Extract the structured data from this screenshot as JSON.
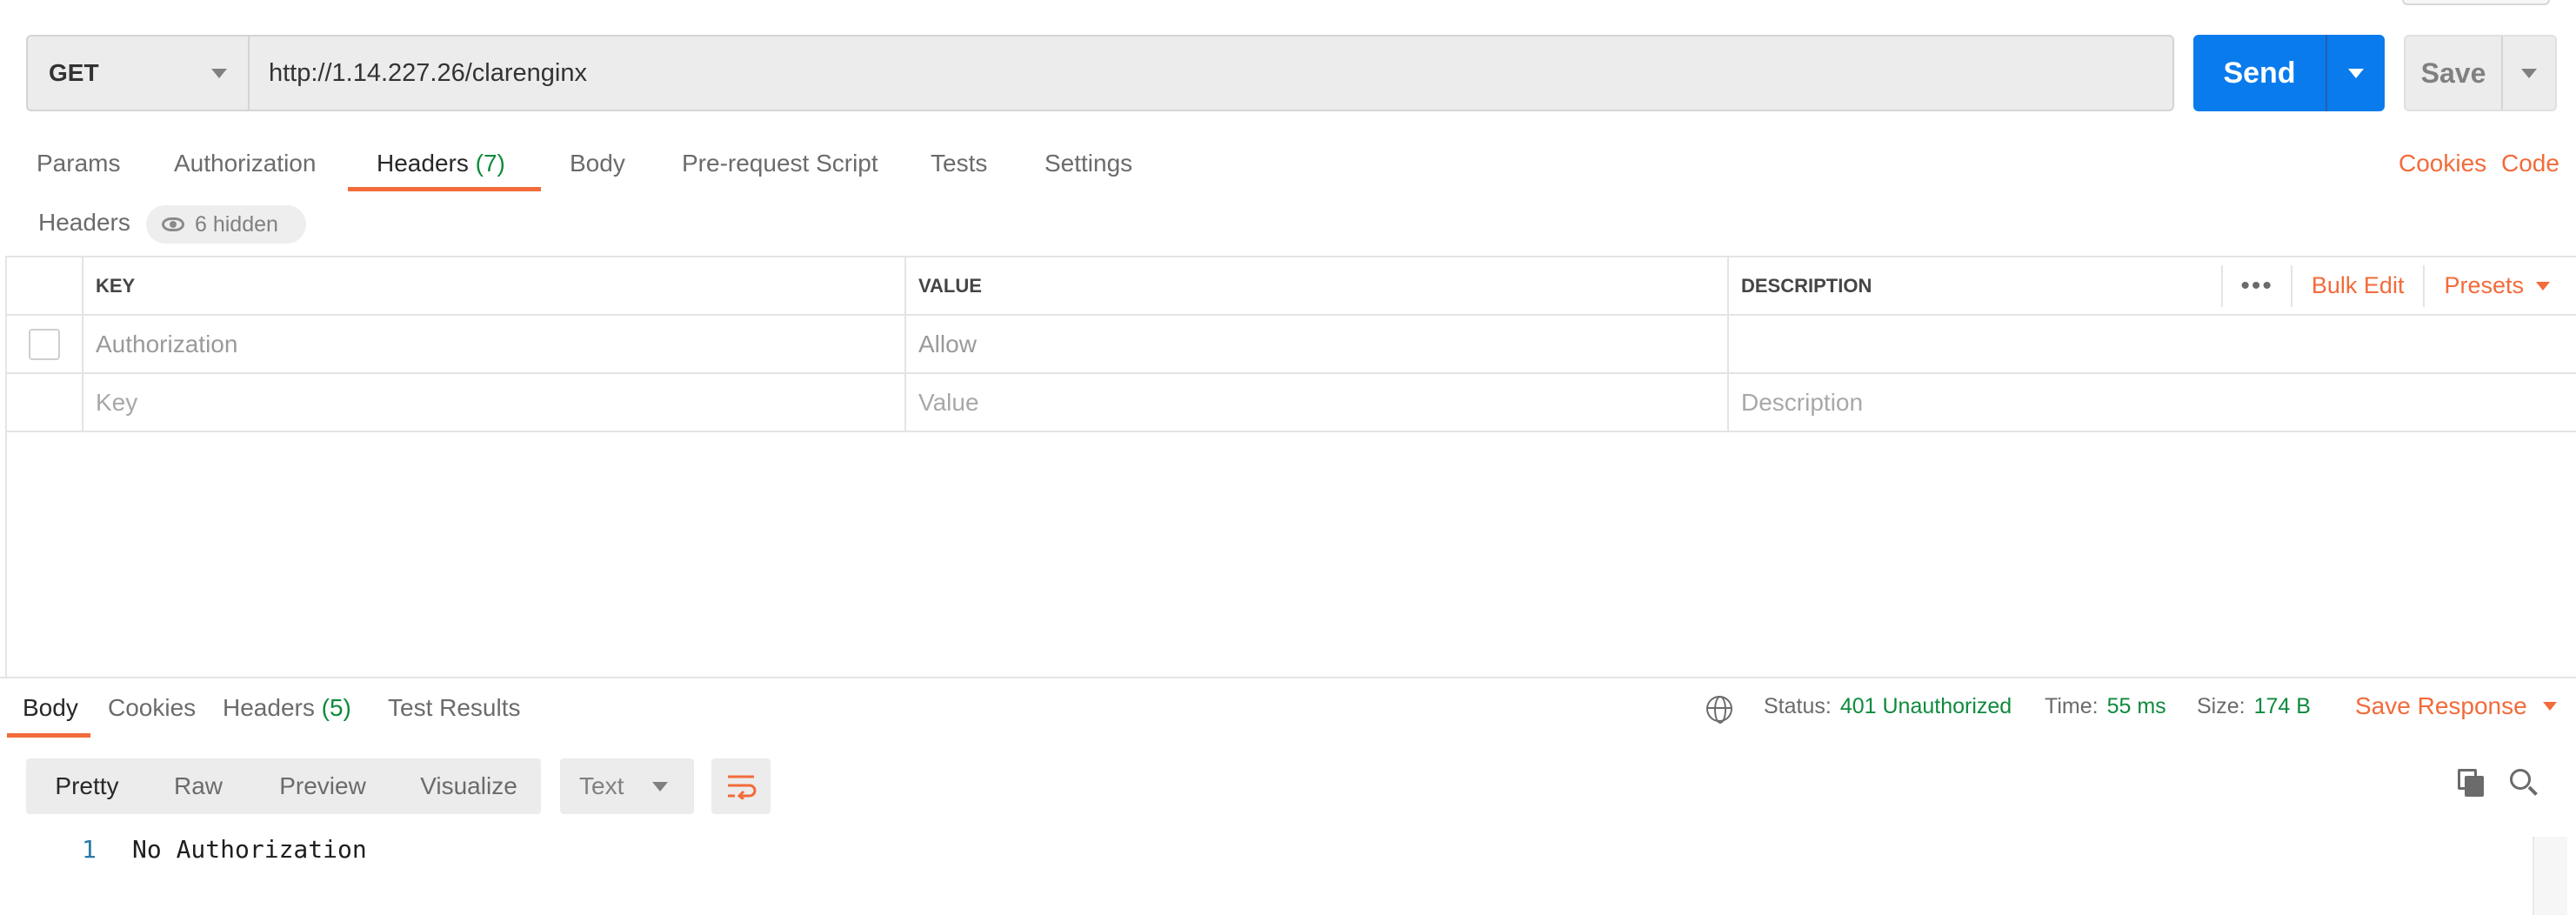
{
  "request": {
    "method": "GET",
    "url": "http://1.14.227.26/clarenginx",
    "send_label": "Send",
    "save_label": "Save"
  },
  "request_tabs": {
    "params": "Params",
    "authorization": "Authorization",
    "headers": "Headers",
    "headers_count": "(7)",
    "body": "Body",
    "prerequest": "Pre-request Script",
    "tests": "Tests",
    "settings": "Settings",
    "cookies": "Cookies",
    "code": "Code"
  },
  "headers_section": {
    "title": "Headers",
    "hidden_label": "6 hidden",
    "columns": {
      "key": "KEY",
      "value": "VALUE",
      "description": "DESCRIPTION"
    },
    "more_label": "•••",
    "bulk_edit": "Bulk Edit",
    "presets": "Presets",
    "rows": [
      {
        "key": "Authorization",
        "value": "Allow",
        "description": ""
      }
    ],
    "placeholder": {
      "key": "Key",
      "value": "Value",
      "description": "Description"
    }
  },
  "response": {
    "tabs": {
      "body": "Body",
      "cookies": "Cookies",
      "headers": "Headers",
      "headers_count": "(5)",
      "test_results": "Test Results"
    },
    "status_label": "Status:",
    "status_value": "401 Unauthorized",
    "time_label": "Time:",
    "time_value": "55 ms",
    "size_label": "Size:",
    "size_value": "174 B",
    "save_response": "Save Response",
    "views": {
      "pretty": "Pretty",
      "raw": "Raw",
      "preview": "Preview",
      "visualize": "Visualize"
    },
    "format": "Text",
    "body_lines": [
      {
        "num": "1",
        "text": "No Authorization"
      }
    ]
  },
  "colors": {
    "accent": "#f26b3a",
    "primary": "#097bed",
    "success": "#0f8a3d"
  },
  "icons": [
    "eye-icon",
    "globe-icon",
    "copy-icon",
    "search-icon",
    "wrap-lines-icon",
    "chevron-down-icon"
  ]
}
